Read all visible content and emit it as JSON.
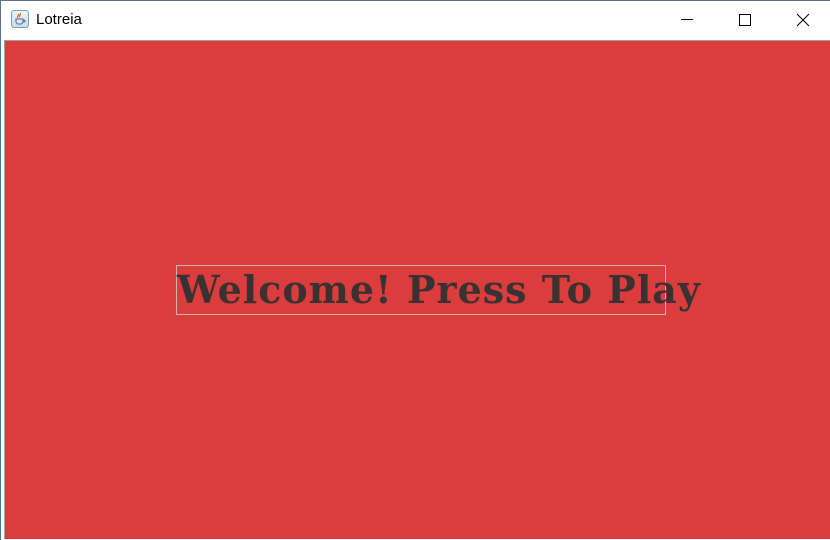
{
  "window": {
    "title": "Lotreia",
    "app_icon": "java-cup-icon",
    "controls": {
      "minimize_icon": "minimize-icon",
      "maximize_icon": "maximize-icon",
      "close_icon": "close-icon"
    }
  },
  "main": {
    "background_color": "#db3c3c",
    "start_button_label": "Welcome! Press To Play",
    "start_button_text_color": "#3a3232"
  }
}
